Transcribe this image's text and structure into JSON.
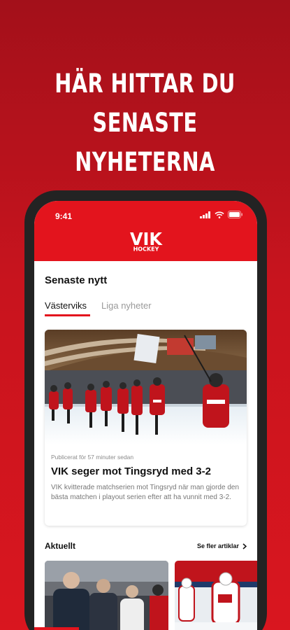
{
  "promo": {
    "headline_line1": "HÄR HITTAR DU",
    "headline_line2": "SENASTE NYHETERNA"
  },
  "status_bar": {
    "time": "9:41",
    "icons": [
      "cellular-signal-icon",
      "wifi-icon",
      "battery-icon"
    ]
  },
  "app": {
    "logo_text": "VIK",
    "logo_subtext": "HOCKEY",
    "brand_color": "#e3141d"
  },
  "news": {
    "section_title": "Senaste nytt",
    "tabs": [
      {
        "label": "Västerviks",
        "active": true
      },
      {
        "label": "Liga nyheter",
        "active": false
      }
    ],
    "featured": {
      "published": "Publicerat för 57 minuter sedan",
      "title": "VIK seger mot Tingsryd med 3-2",
      "description": "VIK kvitterade matchserien mot Tingsryd när man gjorde den bästa matchen i playout serien efter att ha vunnit med 3-2."
    }
  },
  "current": {
    "section_title": "Aktuellt",
    "more_label": "Se fler artiklar"
  }
}
